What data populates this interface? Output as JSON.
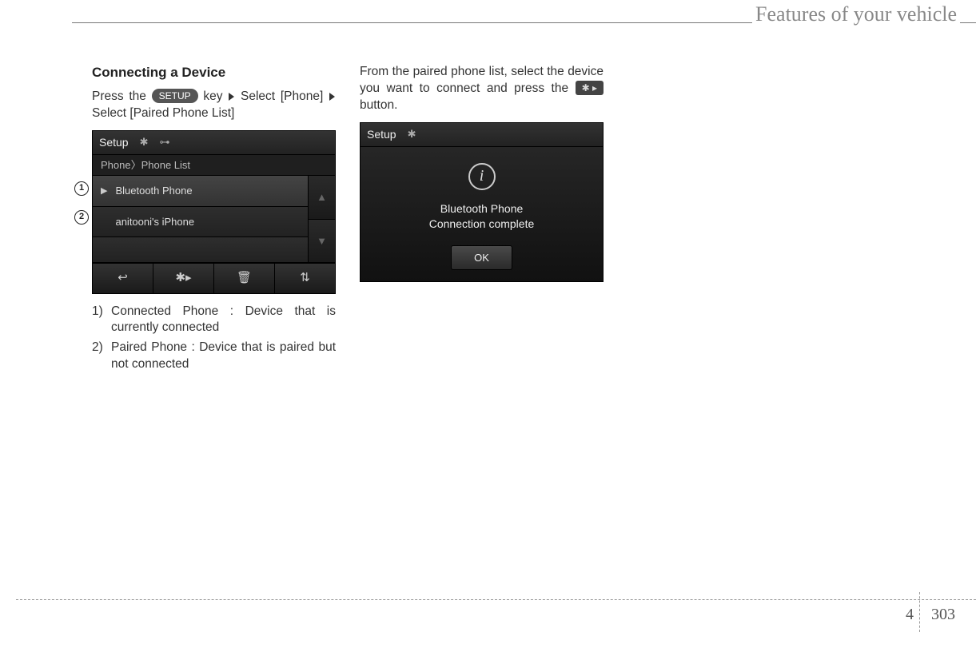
{
  "header": {
    "title": "Features of your vehicle"
  },
  "col1": {
    "heading": "Connecting a Device",
    "instr_pre": "Press the ",
    "setup_label": "SETUP",
    "instr_mid1": " key",
    "instr_mid2": "Select [Phone]",
    "instr_mid3": "Select [Paired Phone List]",
    "shot": {
      "title": "Setup",
      "breadcrumb": "Phone〉Phone List",
      "rows": [
        "Bluetooth Phone",
        "anitooni's iPhone"
      ],
      "bottom_icons": [
        "↩",
        "✱▸",
        "🗑",
        "⇅"
      ]
    },
    "callouts": [
      "1",
      "2"
    ],
    "defs": [
      {
        "n": "1)",
        "t": "Connected Phone : Device that is currently connected"
      },
      {
        "n": "2)",
        "t": "Paired Phone : Device that is paired but not connected"
      }
    ]
  },
  "col2": {
    "instr_pre": "From the paired phone list, select the device you want to connect and press the ",
    "bt_btn": "✱ ▸",
    "instr_post": " button.",
    "shot": {
      "title": "Setup",
      "msg_l1": "Bluetooth Phone",
      "msg_l2": "Connection complete",
      "ok": "OK"
    }
  },
  "footer": {
    "chapter": "4",
    "page": "303"
  }
}
